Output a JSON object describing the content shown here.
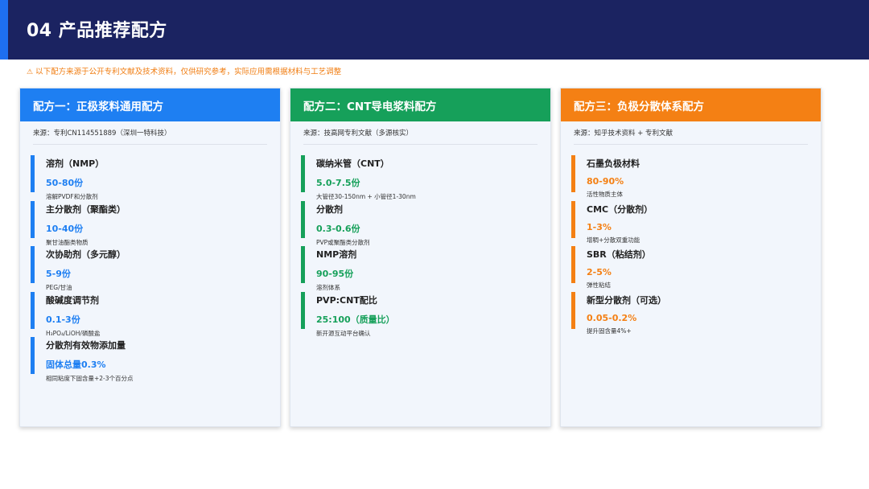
{
  "header": {
    "title": "04  产品推荐配方"
  },
  "notice": {
    "icon": "warning-icon",
    "text": "以下配方来源于公开专利文献及技术资料，仅供研究参考，实际应用需根据材料与工艺调整"
  },
  "colors": {
    "header_bg": "#1b2361",
    "accent_blue": "#1e6ff0",
    "card1": "#1e7ff2",
    "card2": "#16a05a",
    "card3": "#f48014",
    "notice": "#f07d12"
  },
  "cards": [
    {
      "title": "配方一：正极浆料通用配方",
      "source": "来源：专利CN114551889（深圳一特科技）",
      "items": [
        {
          "name": "溶剂（NMP）",
          "value": "50-80份",
          "note": "溶解PVDF和分散剂"
        },
        {
          "name": "主分散剂（聚酯类）",
          "value": "10-40份",
          "note": "聚甘油酯类物质"
        },
        {
          "name": "次协助剂（多元醇）",
          "value": "5-9份",
          "note": "PEG/甘油"
        },
        {
          "name": "酸碱度调节剂",
          "value": "0.1-3份",
          "note": "H₃PO₄/LiOH/磷酸盐"
        },
        {
          "name": "分散剂有效物添加量",
          "value": "固体总量0.3%",
          "note": "相同粘度下固含量+2-3个百分点"
        }
      ]
    },
    {
      "title": "配方二：CNT导电浆料配方",
      "source": "来源：技高网专利文献（多源核实）",
      "items": [
        {
          "name": "碳纳米管（CNT）",
          "value": "5.0-7.5份",
          "note": "大管径30-150nm + 小管径1-30nm"
        },
        {
          "name": "分散剂",
          "value": "0.3-0.6份",
          "note": "PVP或聚酯类分散剂"
        },
        {
          "name": "NMP溶剂",
          "value": "90-95份",
          "note": "溶剂体系"
        },
        {
          "name": "PVP:CNT配比",
          "value": "25:100（质量比）",
          "note": "新开源互动平台确认"
        }
      ]
    },
    {
      "title": "配方三：负极分散体系配方",
      "source": "来源：知乎技术资料 + 专利文献",
      "items": [
        {
          "name": "石墨负极材料",
          "value": "80-90%",
          "note": "活性物质主体"
        },
        {
          "name": "CMC（分散剂）",
          "value": "1-3%",
          "note": "增稠+分散双重功能"
        },
        {
          "name": "SBR（粘结剂）",
          "value": "2-5%",
          "note": "弹性粘结"
        },
        {
          "name": "新型分散剂（可选）",
          "value": "0.05-0.2%",
          "note": "提升固含量4%+"
        }
      ]
    }
  ]
}
